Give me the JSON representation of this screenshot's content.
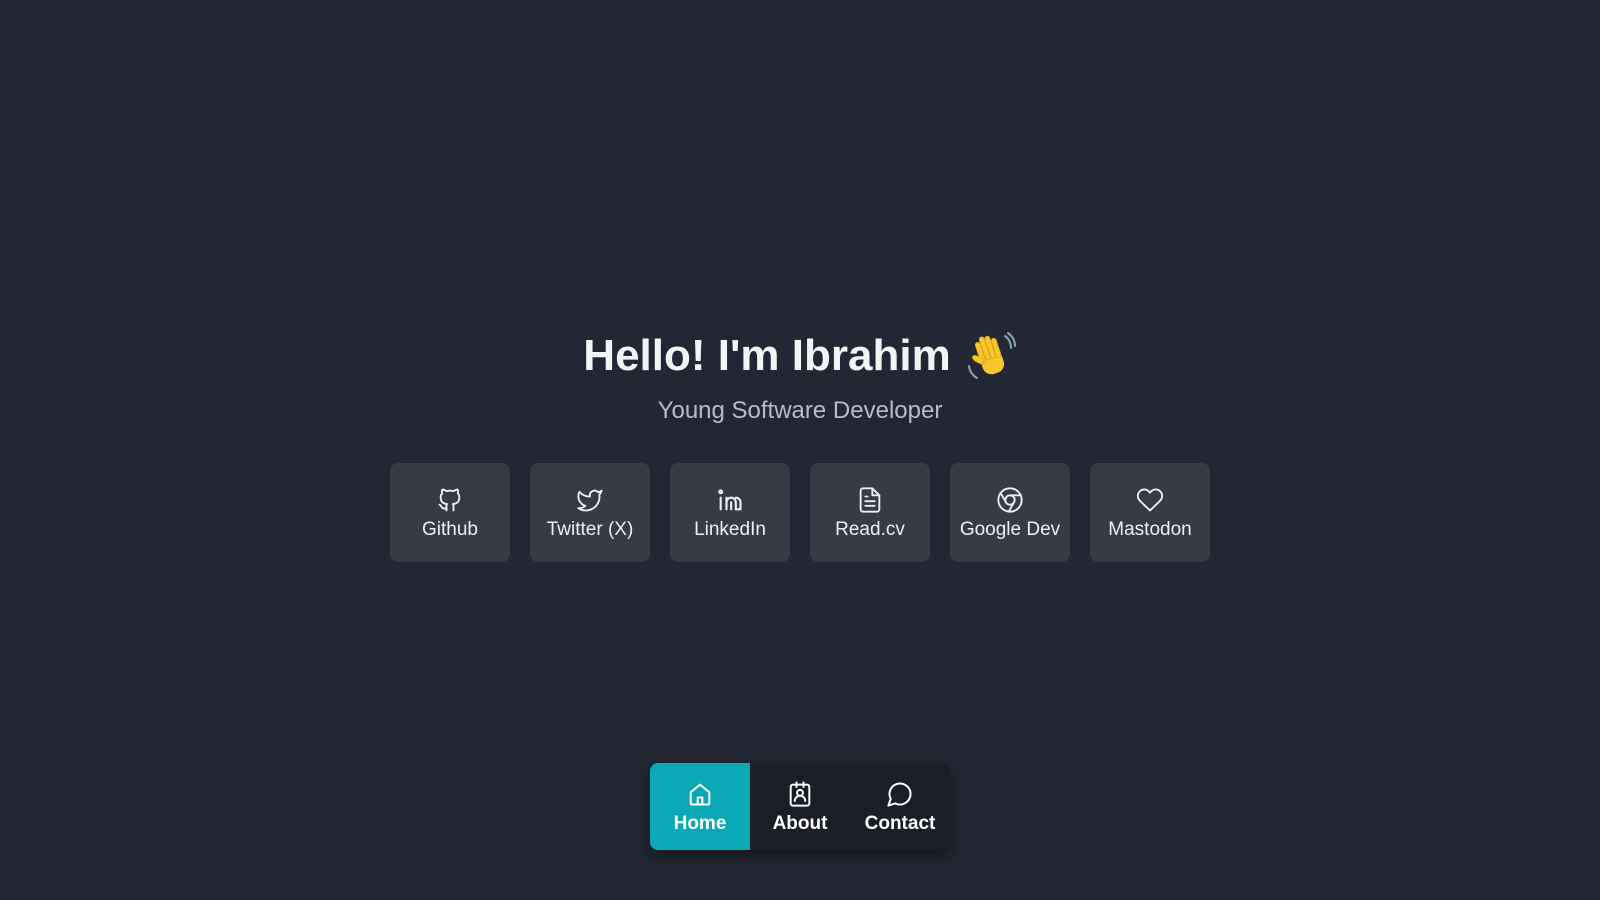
{
  "hero": {
    "headline": "Hello! I'm Ibrahim",
    "headline_emoji_icon": "waving-hand-icon",
    "subtitle": "Young Software Developer"
  },
  "links": [
    {
      "label": "Github",
      "icon": "github-icon"
    },
    {
      "label": "Twitter (X)",
      "icon": "twitter-icon"
    },
    {
      "label": "LinkedIn",
      "icon": "linkedin-icon"
    },
    {
      "label": "Read.cv",
      "icon": "document-icon"
    },
    {
      "label": "Google Dev",
      "icon": "chrome-icon"
    },
    {
      "label": "Mastodon",
      "icon": "heart-icon"
    }
  ],
  "nav": {
    "items": [
      {
        "label": "Home",
        "icon": "home-icon",
        "active": true
      },
      {
        "label": "About",
        "icon": "contact-card-icon",
        "active": false
      },
      {
        "label": "Contact",
        "icon": "chat-bubble-icon",
        "active": false
      }
    ]
  },
  "colors": {
    "background": "#222733",
    "card": "#363b46",
    "nav_background": "#1b1e26",
    "accent": "#0aa9b5",
    "text": "#f3f4f6",
    "subtitle": "#b7bcc6"
  }
}
